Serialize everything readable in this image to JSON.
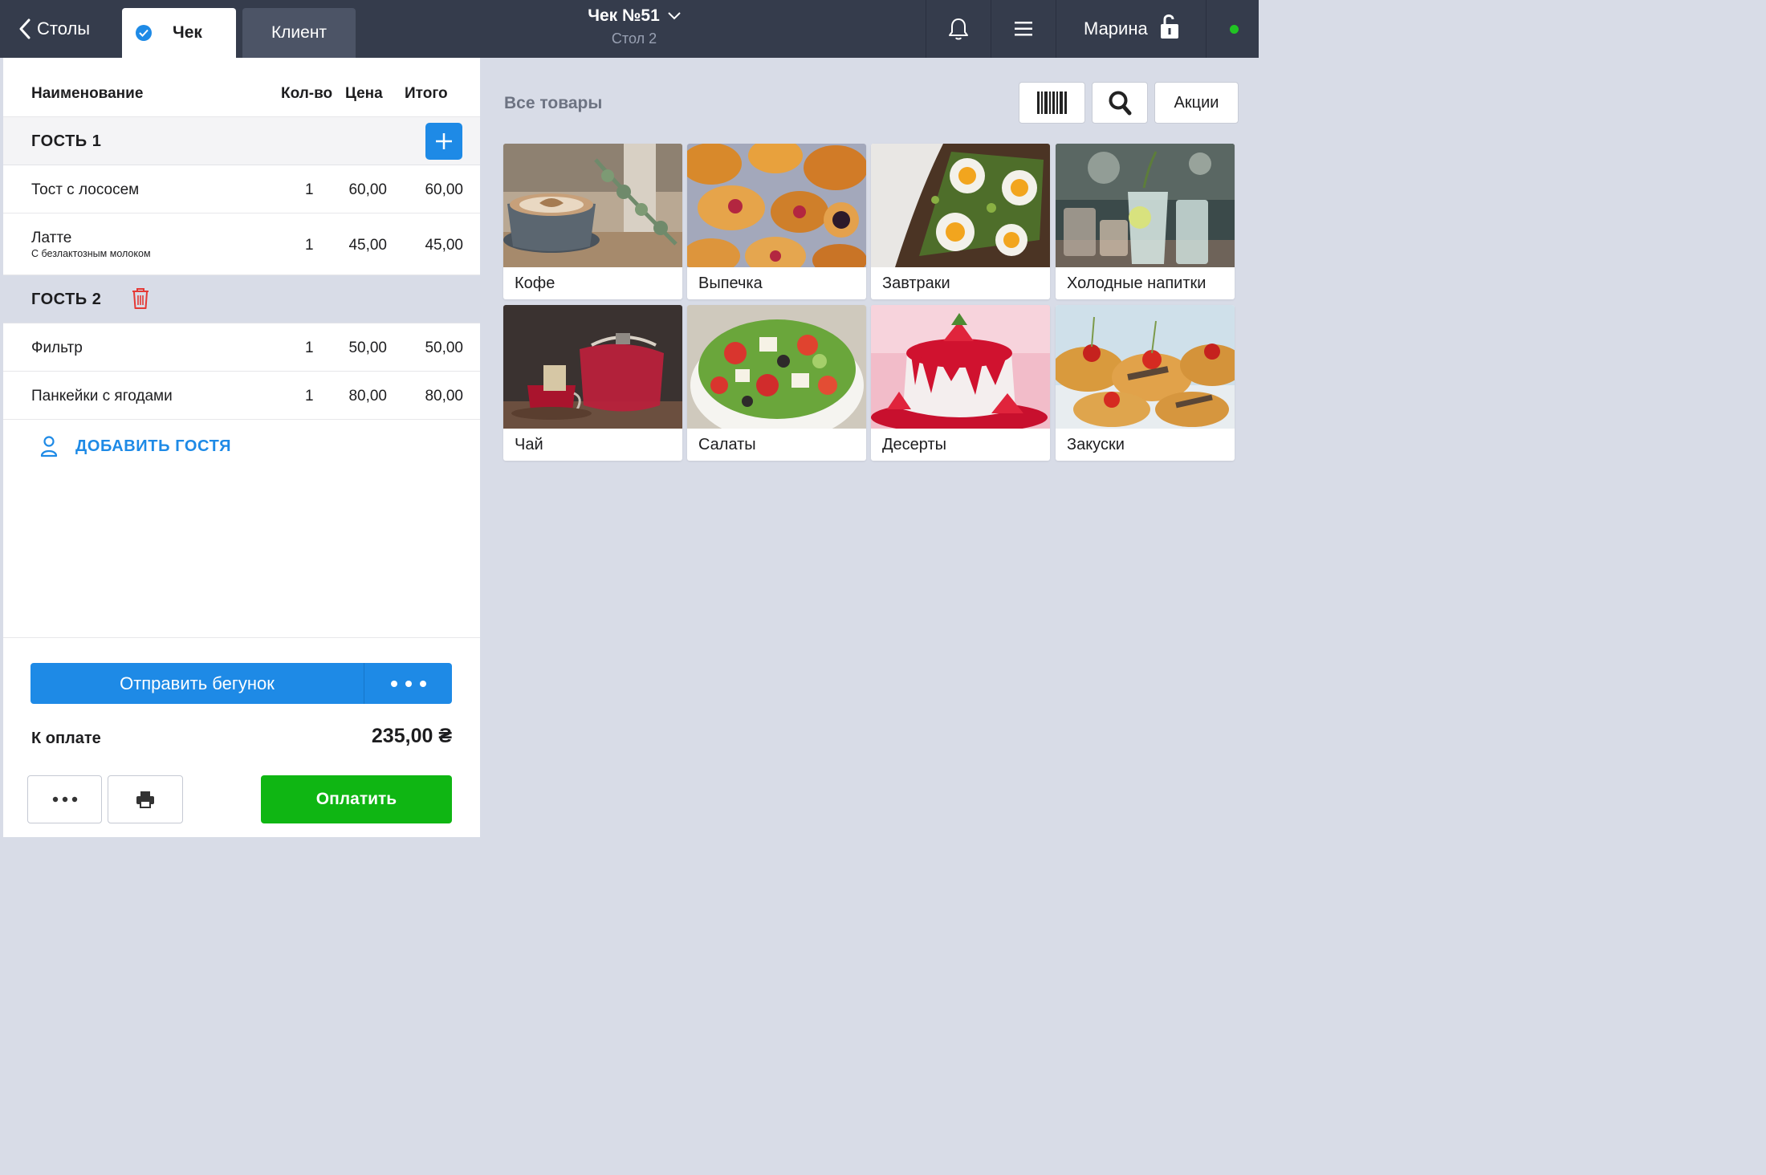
{
  "topbar": {
    "back_label": "Столы",
    "tabs": [
      {
        "label": "Чек",
        "active": true
      },
      {
        "label": "Клиент",
        "active": false
      }
    ],
    "title": "Чек №51",
    "subtitle": "Стол 2",
    "user_name": "Марина",
    "status_color": "#21c423"
  },
  "order": {
    "columns": {
      "name": "Наименование",
      "qty": "Кол-во",
      "price": "Цена",
      "total": "Итого"
    },
    "guests": [
      {
        "label": "ГОСТЬ 1",
        "items": [
          {
            "name": "Тост с лососем",
            "modifier": "",
            "qty": "1",
            "price": "60,00",
            "total": "60,00"
          },
          {
            "name": "Латте",
            "modifier": "С безлактозным молоком",
            "qty": "1",
            "price": "45,00",
            "total": "45,00"
          }
        ]
      },
      {
        "label": "ГОСТЬ 2",
        "items": [
          {
            "name": "Фильтр",
            "modifier": "",
            "qty": "1",
            "price": "50,00",
            "total": "50,00"
          },
          {
            "name": "Панкейки с ягодами",
            "modifier": "",
            "qty": "1",
            "price": "80,00",
            "total": "80,00"
          }
        ]
      }
    ],
    "add_guest_label": "ДОБАВИТЬ ГОСТЯ",
    "send_label": "Отправить бегунок",
    "to_pay_label": "К оплате",
    "to_pay_amount": "235,00 ₴",
    "pay_label": "Оплатить"
  },
  "catalog": {
    "title": "Все товары",
    "promo_label": "Акции",
    "categories": [
      {
        "label": "Кофе",
        "icon": "coffee-photo"
      },
      {
        "label": "Выпечка",
        "icon": "pastry-photo"
      },
      {
        "label": "Завтраки",
        "icon": "breakfast-photo"
      },
      {
        "label": "Холодные напитки",
        "icon": "cold-drink-photo"
      },
      {
        "label": "Чай",
        "icon": "tea-photo"
      },
      {
        "label": "Салаты",
        "icon": "salad-photo"
      },
      {
        "label": "Десерты",
        "icon": "dessert-photo"
      },
      {
        "label": "Закуски",
        "icon": "snacks-photo"
      }
    ]
  },
  "colors": {
    "topbar": "#353c4c",
    "accent": "#1e8ae6",
    "pay": "#0fb613",
    "delete": "#e53935",
    "background": "#d8dce7"
  }
}
